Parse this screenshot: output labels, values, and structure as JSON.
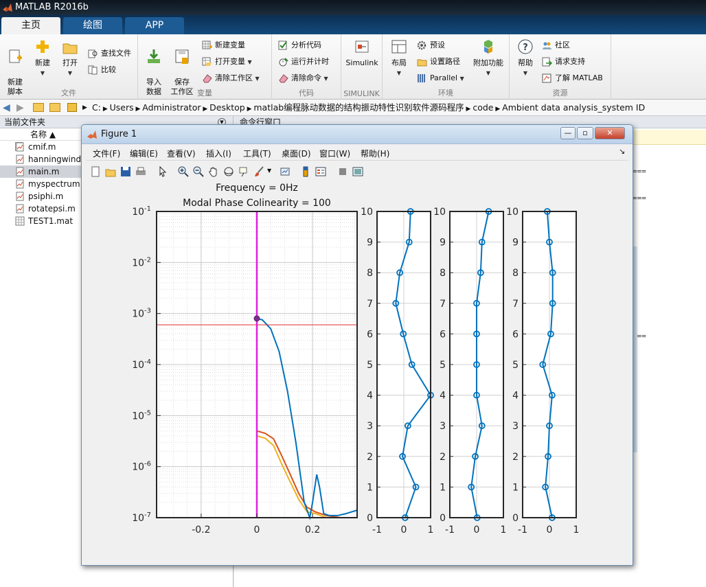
{
  "app": {
    "title": "MATLAB R2016b"
  },
  "tabs": [
    {
      "label": "主页"
    },
    {
      "label": "绘图"
    },
    {
      "label": "APP"
    }
  ],
  "toolstrip": {
    "file": {
      "title": "文件",
      "new_script": "新建\n脚本",
      "new": "新建",
      "open": "打开",
      "find_files": "查找文件",
      "compare": "比较"
    },
    "variable": {
      "title": "变量",
      "import": "导入\n数据",
      "save_ws": "保存\n工作区",
      "new_var": "新建变量",
      "open_var": "打开变量",
      "clear_ws": "清除工作区"
    },
    "code": {
      "title": "代码",
      "analyze": "分析代码",
      "run_time": "运行并计时",
      "clear_cmd": "清除命令"
    },
    "simulink": {
      "title": "SIMULINK",
      "simulink": "Simulink"
    },
    "env": {
      "title": "环境",
      "layout": "布局",
      "preferences": "预设",
      "set_path": "设置路径",
      "parallel": "Parallel",
      "addons": "附加功能"
    },
    "resources": {
      "title": "资源",
      "help": "帮助",
      "community": "社区",
      "support": "请求支持",
      "learn": "了解 MATLAB"
    }
  },
  "address": {
    "segments": [
      "C:",
      "Users",
      "Administrator",
      "Desktop",
      "matlab编程脉动数据的结构振动特性识别软件源码程序",
      "code",
      "Ambient data analysis_system ID"
    ]
  },
  "current_folder": {
    "title": "当前文件夹",
    "col_name": "名称 ▲",
    "files": [
      {
        "name": "cmif.m",
        "type": "m"
      },
      {
        "name": "hanningwindo",
        "type": "m"
      },
      {
        "name": "main.m",
        "type": "m",
        "selected": true
      },
      {
        "name": "myspectrum.n",
        "type": "m"
      },
      {
        "name": "psiphi.m",
        "type": "m"
      },
      {
        "name": "rotatepsi.m",
        "type": "m"
      },
      {
        "name": "TEST1.mat",
        "type": "mat"
      }
    ]
  },
  "command_window": {
    "title": "命令行窗口",
    "eq_marks": [
      "===",
      "===",
      "==="
    ]
  },
  "figure": {
    "title": "Figure 1",
    "menus": [
      "文件(F)",
      "编辑(E)",
      "查看(V)",
      "插入(I)",
      "工具(T)",
      "桌面(D)",
      "窗口(W)",
      "帮助(H)"
    ]
  },
  "chart_data": [
    {
      "type": "line",
      "title": "Frequency = 0Hz",
      "subtitle": "Modal Phase Colinearity = 100",
      "yscale": "log",
      "xlim": [
        -0.36,
        0.36
      ],
      "ylim": [
        1e-07,
        0.1
      ],
      "xticks": [
        -0.2,
        0,
        0.2
      ],
      "xtick_labels": [
        "-0.2",
        "0",
        "0.2"
      ],
      "ytick_labels": [
        "10^-1",
        "10^-2",
        "10^-3",
        "10^-4",
        "10^-5",
        "10^-6",
        "10^-7"
      ],
      "grid": true,
      "colors": {
        "blue": "#0072bd",
        "orange": "#d95319",
        "yellow": "#edb120",
        "magenta": "#e020e0",
        "red": "#e03030",
        "marker": "#7e2f8e"
      },
      "vline_x": 0,
      "hline_y": 0.0006,
      "marker": {
        "x": 0,
        "y": 0.0008
      },
      "series": [
        {
          "values_x": [
            0,
            0.02,
            0.05,
            0.08,
            0.11,
            0.14,
            0.17,
            0.19,
            0.2,
            0.215,
            0.225,
            0.24,
            0.26,
            0.29,
            0.32,
            0.36
          ],
          "values_y": [
            0.0008,
            0.00075,
            0.0005,
            0.00018,
            3e-05,
            3e-06,
            2e-07,
            1.5e-08,
            2e-07,
            7e-07,
            4e-07,
            1.2e-07,
            1.1e-07,
            1.1e-07,
            1.2e-07,
            1.4e-07
          ]
        },
        {
          "values_x": [
            0,
            0.03,
            0.06,
            0.09,
            0.12,
            0.15,
            0.18,
            0.21,
            0.25,
            0.3,
            0.36
          ],
          "values_y": [
            5e-06,
            4.5e-06,
            3.5e-06,
            1.6e-06,
            7e-07,
            3e-07,
            1.6e-07,
            1.3e-07,
            1.1e-07,
            9e-08,
            8e-08
          ]
        },
        {
          "values_x": [
            0,
            0.03,
            0.06,
            0.09,
            0.12,
            0.15,
            0.18,
            0.21,
            0.25,
            0.3,
            0.36
          ],
          "values_y": [
            4e-06,
            3.6e-06,
            2.6e-06,
            1.1e-06,
            5e-07,
            2.3e-07,
            1.3e-07,
            1.2e-07,
            1e-07,
            8e-08,
            7e-08
          ]
        }
      ]
    },
    {
      "type": "line",
      "xlim": [
        -1,
        1
      ],
      "ylim": [
        0,
        10
      ],
      "xtick_labels": [
        "-1",
        "0",
        "1"
      ],
      "ytick_labels": [
        "0",
        "1",
        "2",
        "3",
        "4",
        "5",
        "6",
        "7",
        "8",
        "9",
        "10"
      ],
      "y": [
        0,
        1,
        2,
        3,
        4,
        5,
        6,
        7,
        8,
        9,
        10
      ],
      "x": [
        0.05,
        0.45,
        -0.05,
        0.15,
        1.0,
        0.3,
        -0.02,
        -0.3,
        -0.15,
        0.2,
        0.25
      ]
    },
    {
      "type": "line",
      "xlim": [
        -1,
        1
      ],
      "ylim": [
        0,
        10
      ],
      "xtick_labels": [
        "-1",
        "0",
        "1"
      ],
      "ytick_labels": [
        "0",
        "1",
        "2",
        "3",
        "4",
        "5",
        "6",
        "7",
        "8",
        "9",
        "10"
      ],
      "y": [
        0,
        1,
        2,
        3,
        4,
        5,
        6,
        7,
        8,
        9,
        10
      ],
      "x": [
        0.02,
        -0.2,
        -0.05,
        0.2,
        0.0,
        0.0,
        0.0,
        0.0,
        0.15,
        0.2,
        0.45
      ]
    },
    {
      "type": "line",
      "xlim": [
        -1,
        1
      ],
      "ylim": [
        0,
        10
      ],
      "xtick_labels": [
        "-1",
        "0",
        "1"
      ],
      "ytick_labels": [
        "0",
        "1",
        "2",
        "3",
        "4",
        "5",
        "6",
        "7",
        "8",
        "9",
        "10"
      ],
      "y": [
        0,
        1,
        2,
        3,
        4,
        5,
        6,
        7,
        8,
        9,
        10
      ],
      "x": [
        0.1,
        -0.15,
        -0.05,
        0.0,
        0.1,
        -0.25,
        0.05,
        0.12,
        0.12,
        0.0,
        -0.08
      ]
    }
  ]
}
